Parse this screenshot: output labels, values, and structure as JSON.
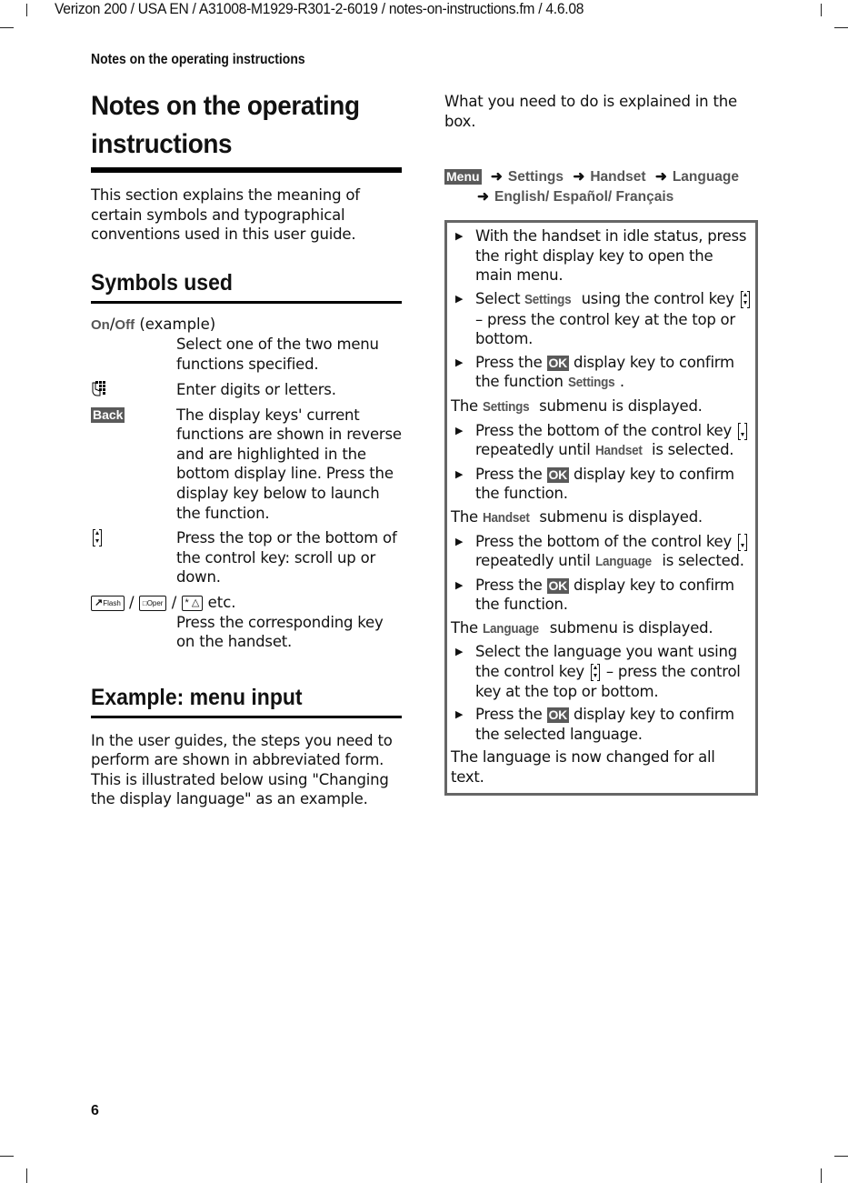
{
  "running_header": "Verizon 200 / USA EN / A31008-M1929-R301-2-6019 / notes-on-instructions.fm / 4.6.08",
  "page_header": "Notes on the operating instructions",
  "page_number": "6",
  "left": {
    "title": "Notes on the operating instructions",
    "intro": "This section explains the meaning of certain symbols and typographical conventions used in this user guide.",
    "symbols_heading": "Symbols used",
    "symbols": [
      {
        "key_on": "On",
        "key_sep": "/",
        "key_off": "Off",
        "key_suffix": " (example)",
        "desc": "Select one of the two menu functions specified."
      },
      {
        "icon": "keypad-icon",
        "desc": "Enter digits or letters."
      },
      {
        "badge": "Back",
        "desc": "The display keys' current functions are shown in reverse and are highlighted in the bottom display line. Press the display key below to launch the function."
      },
      {
        "icon": "control-key-icon",
        "desc": "Press the top or the bottom of the control key: scroll up or down."
      },
      {
        "keys": [
          "Flash",
          "Oper",
          "* △"
        ],
        "sep": "/",
        "suffix": "etc.",
        "desc": "Press the corresponding key on the handset."
      }
    ],
    "example_heading": "Example: menu input",
    "example_text": "In the user guides, the steps you need to perform are shown in abbreviated form. This is illustrated below using \"Changing the display language\" as an example."
  },
  "right": {
    "intro": "What you need to do is explained in the box.",
    "path": {
      "menu_badge": "Menu",
      "items": [
        "Settings",
        "Handset",
        "Language"
      ],
      "options": "English/ Español/ Français"
    },
    "steps": {
      "s1": "With the handset in idle status, press the right display key to open the main menu.",
      "s2_a": "Select ",
      "s2_term": "Settings",
      "s2_b": " using the control key ",
      "s2_c": " – press the control key at the top or bottom.",
      "ok": "OK",
      "press_the": "Press the ",
      "confirm_the_function": " display key to confirm the function ",
      "confirm_function": " display key to confirm the function.",
      "confirm_language": " display key to confirm the selected language.",
      "settings_term": "Settings",
      "note_the": "The ",
      "note_submenu": " submenu is displayed.",
      "bottom_a": "Press the bottom of the control key ",
      "bottom_b": " repeatedly until ",
      "bottom_c": " is selected.",
      "handset_term": "Handset",
      "language_term": "Language",
      "s7_a": "Select the language you want using the control key ",
      "s7_b": " – press the control key at the top or bottom.",
      "final": "The language is now changed for all text."
    }
  }
}
